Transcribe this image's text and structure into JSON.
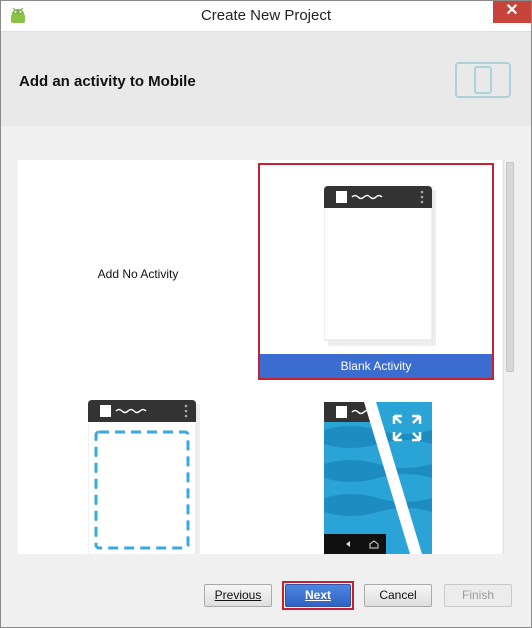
{
  "window": {
    "title": "Create New Project"
  },
  "header": {
    "title": "Add an activity to Mobile"
  },
  "gallery": {
    "tiles": [
      {
        "label": "Add No Activity",
        "selected": false
      },
      {
        "label": "Blank Activity",
        "selected": true
      },
      {
        "label": "",
        "selected": false
      },
      {
        "label": "",
        "selected": false
      }
    ]
  },
  "buttons": {
    "previous": "Previous",
    "next": "Next",
    "cancel": "Cancel",
    "finish": "Finish"
  },
  "colors": {
    "selection_border": "#c8202f",
    "caption_bg": "#3b6ccf",
    "phone_bar": "#333333",
    "fullscreen_blue": "#2aa3d6"
  }
}
